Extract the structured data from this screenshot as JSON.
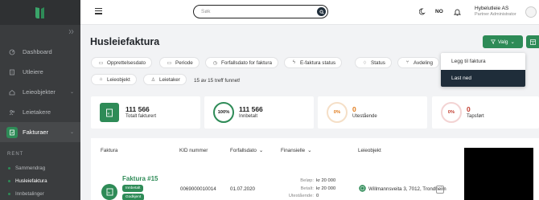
{
  "sidebar": {
    "items": [
      {
        "label": "Dashboard"
      },
      {
        "label": "Utleiere"
      },
      {
        "label": "Leieobjekter"
      },
      {
        "label": "Leietakere"
      },
      {
        "label": "Fakturaer"
      }
    ],
    "section_label": "RENT",
    "sub_items": [
      {
        "label": "Sammendrag"
      },
      {
        "label": "Husleiefaktura"
      },
      {
        "label": "Innbetalinger"
      }
    ]
  },
  "header": {
    "search_placeholder": "Søk",
    "language": "NO",
    "org_name": "Hybelutleie AS",
    "org_role": "Partner Administrator"
  },
  "page": {
    "title": "Husleiefaktura",
    "valg_label": "Valg",
    "filters": [
      "Opprettelsesdato",
      "Periode",
      "Forfallsdato for faktura",
      "E-faktura status",
      "Status",
      "Avdeling",
      "Leieobjekt",
      "Leietaker"
    ],
    "result_count": "15 av 15 treff funnet!"
  },
  "dropdown": {
    "items": [
      "Legg til faktura",
      "Last ned"
    ]
  },
  "stats": [
    {
      "value": "111 566",
      "label": "Totalt fakturert",
      "badge": ""
    },
    {
      "value": "111 566",
      "label": "Innbetalt",
      "badge": "100%"
    },
    {
      "value": "0",
      "label": "Utestående",
      "badge": "0%"
    },
    {
      "value": "0",
      "label": "Tapsført",
      "badge": "0%"
    }
  ],
  "table": {
    "headers": [
      "Faktura",
      "KID nummer",
      "Forfallsdato",
      "Finansielle",
      "Leieobjekt"
    ],
    "row": {
      "title": "Faktura #15",
      "status_badge": "Innbetalt",
      "status_badge2": "Godkjent",
      "kid": "0069000010014",
      "due_date": "01.07.2020",
      "amount_label": "Beløp:",
      "amount": "kr 20 000",
      "paid_label": "Betalt:",
      "paid": "kr 20 000",
      "outstanding_label": "Utestående:",
      "outstanding": "0",
      "address": "Willmannsveita 3, 7012, Trondheim"
    }
  },
  "colors": {
    "accent": "#2e8b57",
    "sidebar": "#3a3c3e",
    "dark": "#1f2d3a"
  }
}
